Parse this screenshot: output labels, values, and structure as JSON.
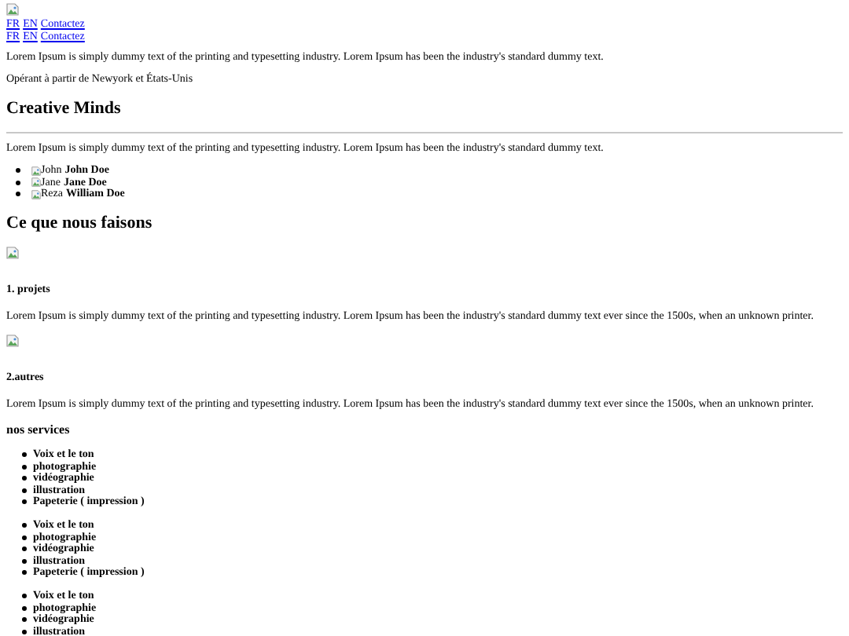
{
  "nav_rows": [
    {
      "links": [
        "FR",
        "EN",
        "Contactez"
      ]
    },
    {
      "links": [
        "FR",
        "EN",
        "Contactez"
      ]
    }
  ],
  "intro": "Lorem Ipsum is simply dummy text of the printing and typesetting industry. Lorem Ipsum has been the industry's standard dummy text.",
  "location": "Opérant à partir de Newyork et États-Unis",
  "heading": "Creative Minds",
  "team_intro": "Lorem Ipsum is simply dummy text of the printing and typesetting industry. Lorem Ipsum has been the industry's standard dummy text.",
  "team": [
    {
      "alt": "John",
      "name": "John Doe"
    },
    {
      "alt": "Jane",
      "name": "Jane Doe"
    },
    {
      "alt": "Reza",
      "name": "William Doe"
    }
  ],
  "section_title": "Ce que nous faisons",
  "work_items": [
    {
      "title": "1. projets",
      "text": "Lorem Ipsum is simply dummy text of the printing and typesetting industry. Lorem Ipsum has been the industry's standard dummy text ever since the 1500s, when an unknown printer."
    },
    {
      "title": "2.autres",
      "text": "Lorem Ipsum is simply dummy text of the printing and typesetting industry. Lorem Ipsum has been the industry's standard dummy text ever since the 1500s, when an unknown printer."
    }
  ],
  "services_title": "nos services",
  "service_lists": [
    [
      "Voix et le ton",
      "photographie",
      "vidéographie",
      "illustration",
      "Papeterie ( impression )"
    ],
    [
      "Voix et le ton",
      "photographie",
      "vidéographie",
      "illustration",
      "Papeterie ( impression )"
    ],
    [
      "Voix et le ton",
      "photographie",
      "vidéographie",
      "illustration"
    ]
  ]
}
